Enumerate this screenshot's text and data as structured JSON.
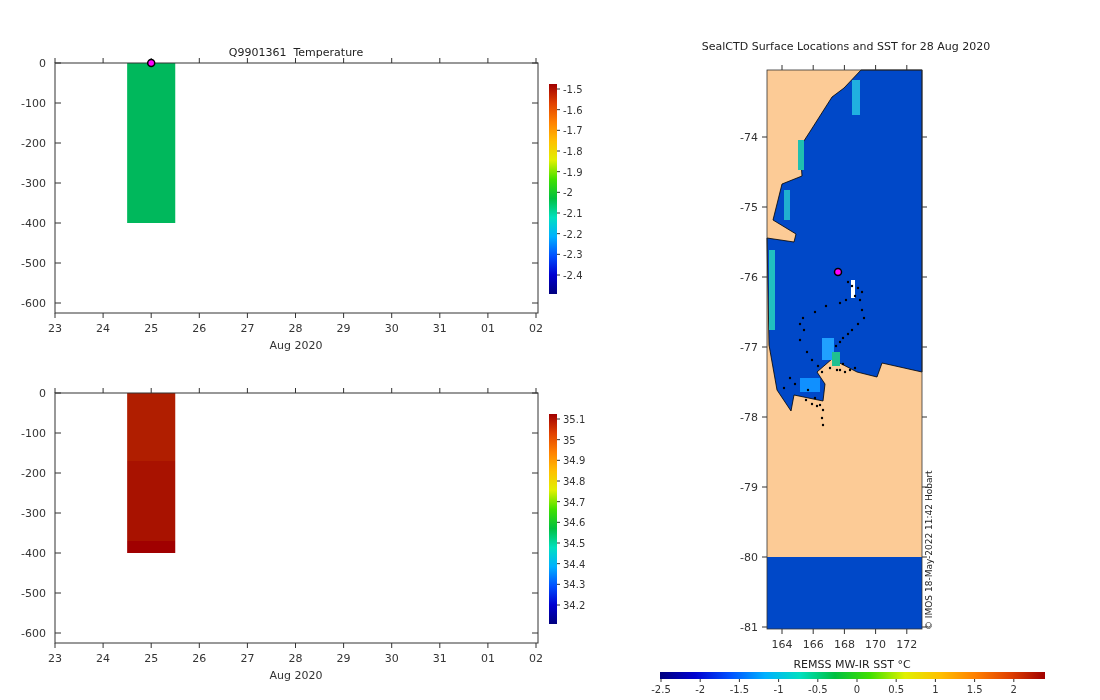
{
  "panels": [
    {
      "title": "Q9901361  Temperature",
      "marker": true,
      "chart_data": {
        "type": "bar",
        "x": [
          "2020-08-25"
        ],
        "series": [
          {
            "color": "#00b85c",
            "values": [
              -400
            ]
          }
        ],
        "xlim": [
          "2020-08-23",
          "2020-09-02"
        ],
        "ylim": [
          -625,
          0
        ],
        "xlabel": "Aug 2020",
        "xticks": [
          {
            "value": "2020-08-23",
            "label": "23"
          },
          {
            "value": "2020-08-24",
            "label": "24"
          },
          {
            "value": "2020-08-25",
            "label": "25"
          },
          {
            "value": "2020-08-26",
            "label": "26"
          },
          {
            "value": "2020-08-27",
            "label": "27"
          },
          {
            "value": "2020-08-28",
            "label": "28"
          },
          {
            "value": "2020-08-29",
            "label": "29"
          },
          {
            "value": "2020-08-30",
            "label": "30"
          },
          {
            "value": "2020-08-31",
            "label": "31"
          },
          {
            "value": "2020-09-01",
            "label": "01"
          },
          {
            "value": "2020-09-02",
            "label": "02"
          }
        ],
        "yticks": [
          0,
          -100,
          -200,
          -300,
          -400,
          -500,
          -600
        ]
      },
      "colorbar": {
        "ticks": [
          "-1.5",
          "-1.6",
          "-1.7",
          "-1.8",
          "-1.9",
          "-2",
          "-2.1",
          "-2.2",
          "-2.3",
          "-2.4"
        ]
      }
    },
    {
      "marker": false,
      "chart_data": {
        "type": "bar",
        "stacked": true,
        "x": [
          "2020-08-25"
        ],
        "series": [
          {
            "color": "#b01e00",
            "values": [
              -170
            ]
          },
          {
            "color": "#a81200",
            "values": [
              -200
            ]
          },
          {
            "color": "#a00000",
            "values": [
              -30
            ]
          }
        ],
        "xlim": [
          "2020-08-23",
          "2020-09-02"
        ],
        "ylim": [
          -625,
          0
        ],
        "xlabel": "Aug 2020",
        "xticks": [
          {
            "value": "2020-08-23",
            "label": "23"
          },
          {
            "value": "2020-08-24",
            "label": "24"
          },
          {
            "value": "2020-08-25",
            "label": "25"
          },
          {
            "value": "2020-08-26",
            "label": "26"
          },
          {
            "value": "2020-08-27",
            "label": "27"
          },
          {
            "value": "2020-08-28",
            "label": "28"
          },
          {
            "value": "2020-08-29",
            "label": "29"
          },
          {
            "value": "2020-08-30",
            "label": "30"
          },
          {
            "value": "2020-08-31",
            "label": "31"
          },
          {
            "value": "2020-09-01",
            "label": "01"
          },
          {
            "value": "2020-09-02",
            "label": "02"
          }
        ],
        "yticks": [
          0,
          -100,
          -200,
          -300,
          -400,
          -500,
          -600
        ]
      },
      "colorbar": {
        "ticks": [
          "35.1",
          "35",
          "34.9",
          "34.8",
          "34.7",
          "34.6",
          "34.5",
          "34.4",
          "34.3",
          "34.2"
        ]
      }
    }
  ],
  "map": {
    "title": "SealCTD Surface Locations and SST for 28 Aug 2020",
    "yticks": [
      "-74",
      "-75",
      "-76",
      "-77",
      "-78",
      "-79",
      "-80",
      "-81"
    ],
    "xticks": [
      "164",
      "166",
      "168",
      "170",
      "172"
    ],
    "credit": "© IMOS 18-May-2022 11:42 Hobart",
    "colorbar": {
      "label": "REMSS MW-IR SST °C",
      "ticks": [
        "-2.5",
        "-2",
        "-1.5",
        "-1",
        "-0.5",
        "0",
        "0.5",
        "1",
        "1.5",
        "2"
      ]
    }
  }
}
